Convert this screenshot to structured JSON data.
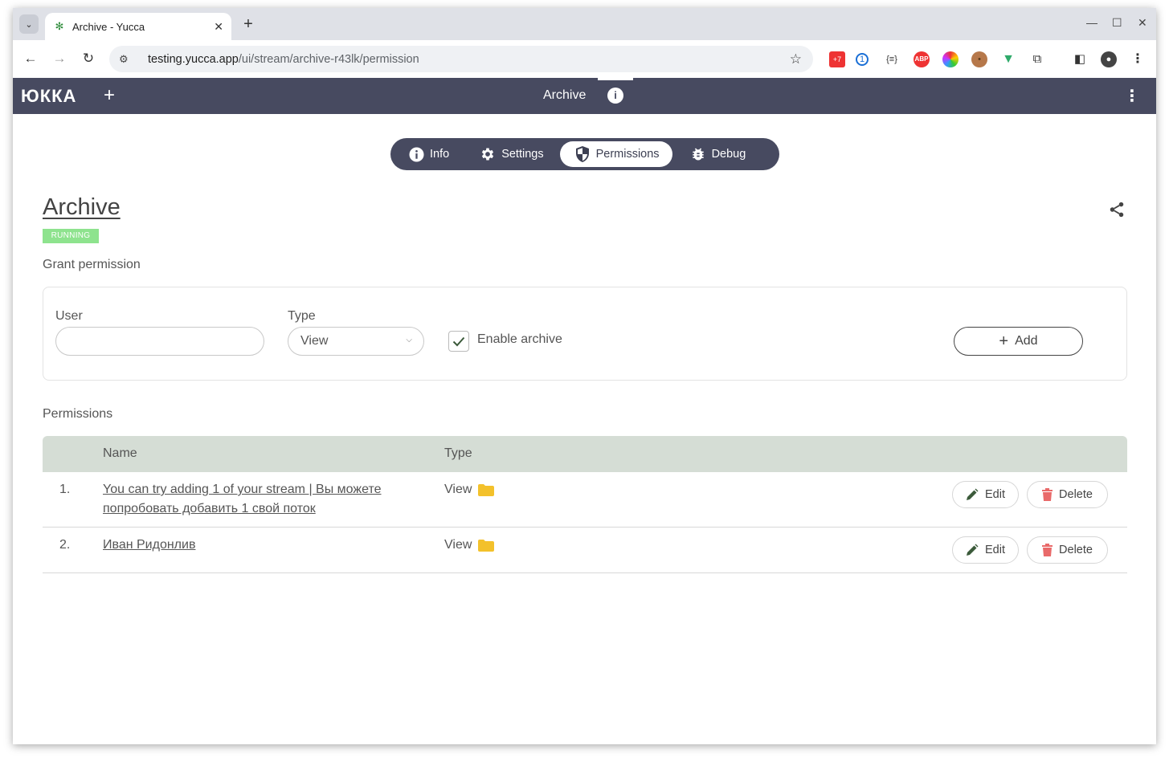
{
  "browser": {
    "tab_title": "Archive - Yucca",
    "url_host": "testing.yucca.app",
    "url_path": "/ui/stream/archive-r43lk/permission"
  },
  "app": {
    "logo": "ЮККА",
    "header_title": "Archive"
  },
  "tabs": [
    {
      "label": "Info",
      "active": false
    },
    {
      "label": "Settings",
      "active": false
    },
    {
      "label": "Permissions",
      "active": true
    },
    {
      "label": "Debug",
      "active": false
    }
  ],
  "stream": {
    "title": "Archive",
    "status": "RUNNING",
    "status_color": "#8ee38e"
  },
  "grant": {
    "section_title": "Grant permission",
    "user_label": "User",
    "user_value": "",
    "type_label": "Type",
    "type_value": "View",
    "enable_archive_label": "Enable archive",
    "enable_archive_checked": true,
    "add_label": "Add"
  },
  "permissions": {
    "section_title": "Permissions",
    "columns": {
      "name": "Name",
      "type": "Type"
    },
    "rows": [
      {
        "index": "1.",
        "name": "You can try adding 1 of your stream | Вы можете попробовать добавить 1 свой поток",
        "type": "View",
        "edit_label": "Edit",
        "delete_label": "Delete"
      },
      {
        "index": "2.",
        "name": "Иван Ридонлив",
        "type": "View",
        "edit_label": "Edit",
        "delete_label": "Delete"
      }
    ]
  },
  "colors": {
    "appbar": "#474a60",
    "folder": "#f3c12b",
    "delete_icon": "#e96a6a",
    "edit_icon": "#3b5a3a"
  }
}
